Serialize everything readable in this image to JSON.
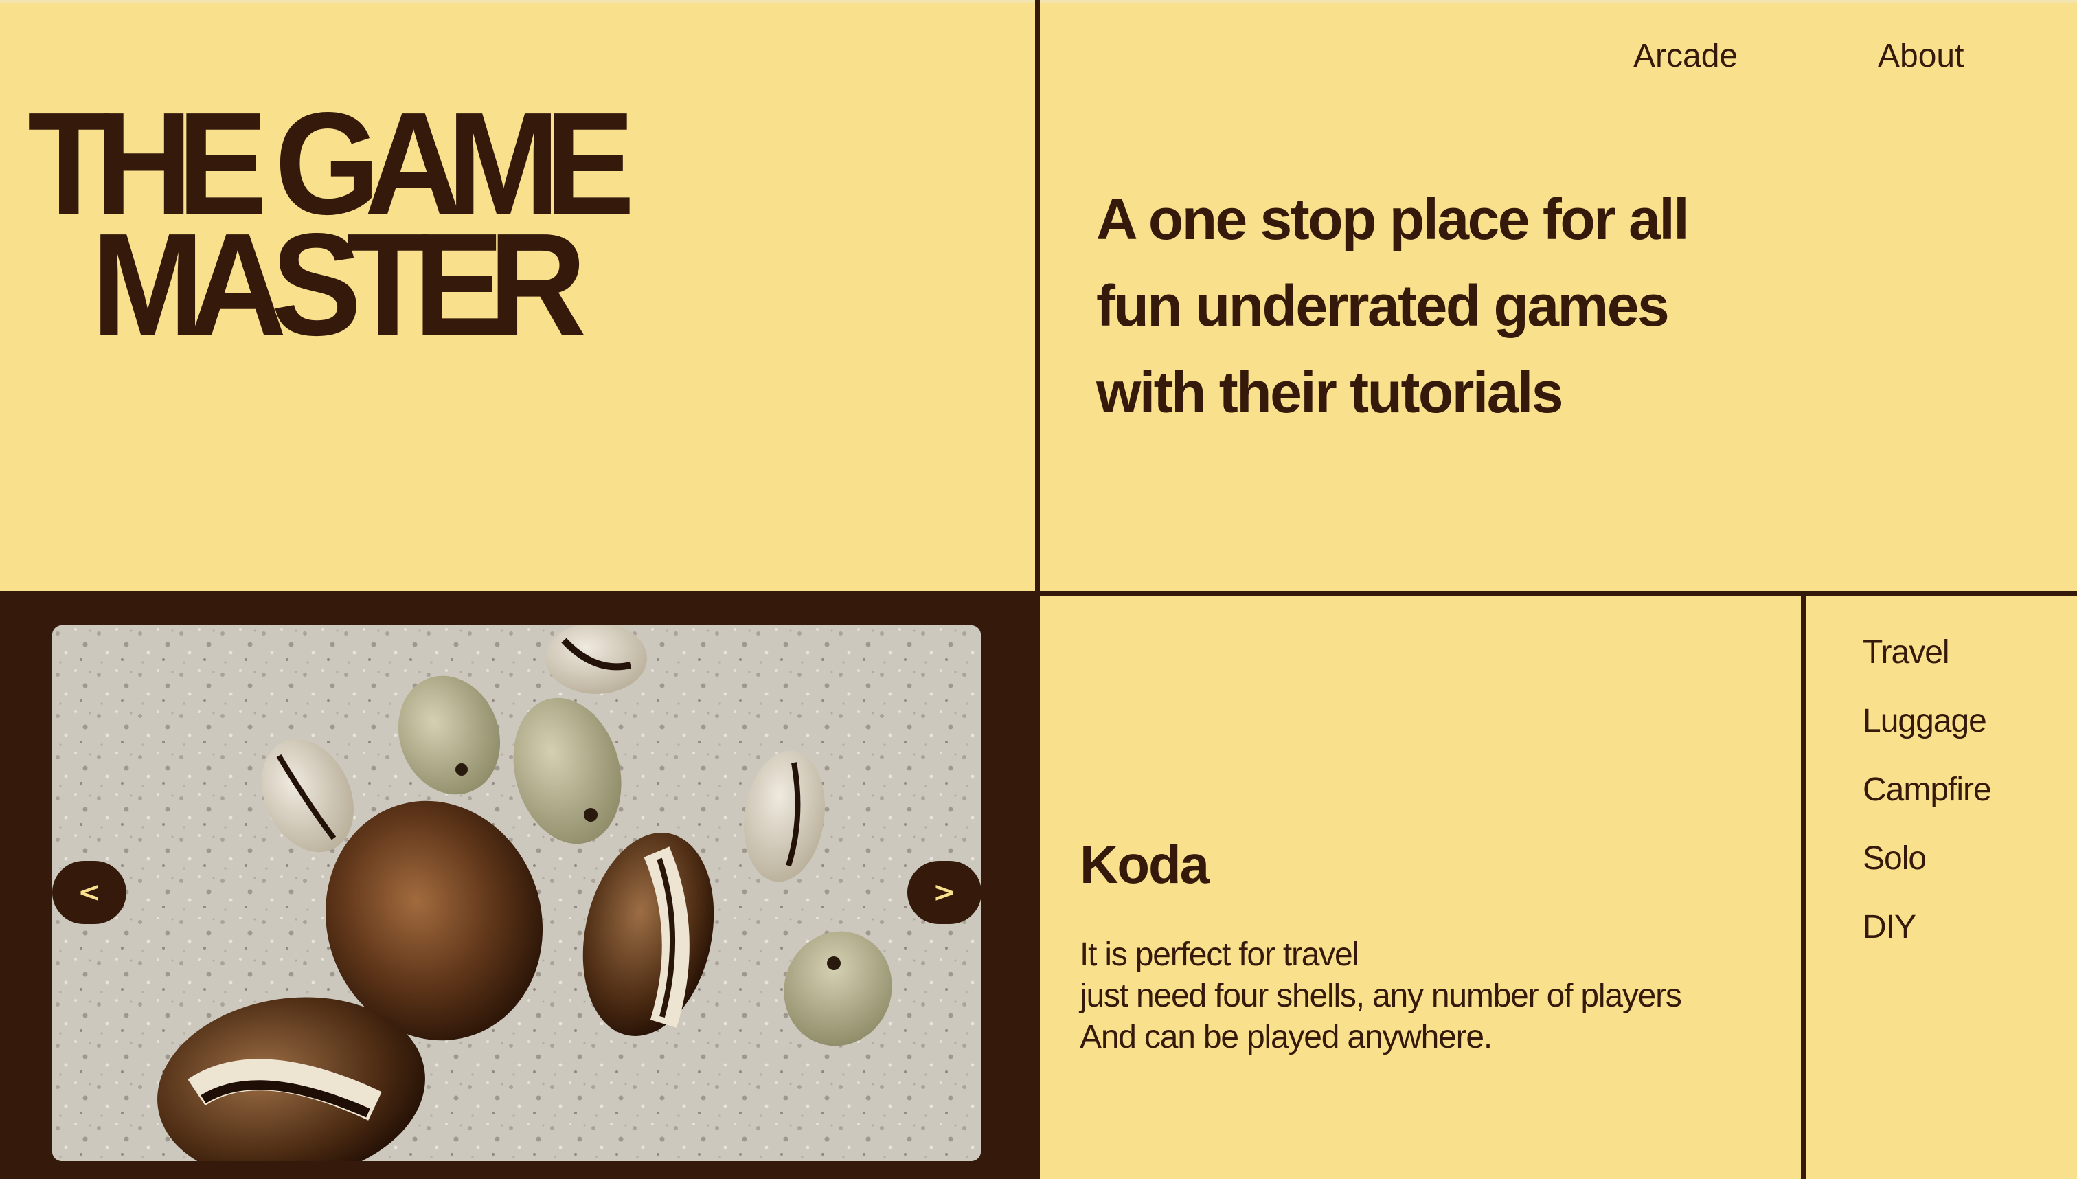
{
  "brand": {
    "title_line1": "THE GAME",
    "title_line2": "MASTER"
  },
  "nav": {
    "items": [
      {
        "label": "Arcade"
      },
      {
        "label": "About"
      }
    ]
  },
  "hero": {
    "tagline_line1": "A one stop place for all",
    "tagline_line2": "fun underrated games",
    "tagline_line3": "with their tutorials"
  },
  "carousel": {
    "prev_label": "<",
    "next_label": ">"
  },
  "game": {
    "title": "Koda",
    "description_lines": [
      "It is perfect for travel",
      "just need four shells, any number of players",
      "And can be played anywhere."
    ]
  },
  "categories": [
    {
      "label": "Travel"
    },
    {
      "label": "Luggage"
    },
    {
      "label": "Campfire"
    },
    {
      "label": "Solo"
    },
    {
      "label": "DIY"
    }
  ],
  "colors": {
    "background": "#F9E08C",
    "dark": "#351A0C"
  }
}
